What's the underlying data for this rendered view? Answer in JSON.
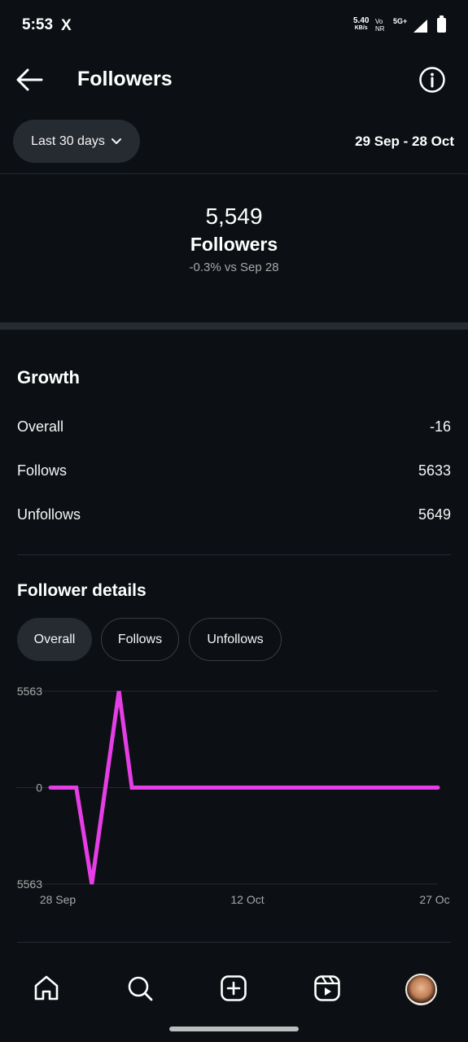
{
  "status_bar": {
    "time": "5:53",
    "x_icon": "X",
    "speed_value": "5.40",
    "speed_unit": "KB/s",
    "volte_top": "Vo",
    "volte_bottom": "NR",
    "network": "5G+"
  },
  "header": {
    "title": "Followers",
    "back_icon": "arrow-left-icon",
    "info_icon": "info-icon"
  },
  "filter": {
    "range_label": "Last 30 days",
    "date_range": "29 Sep - 28 Oct"
  },
  "summary": {
    "value": "5,549",
    "label": "Followers",
    "change": "-0.3% vs Sep 28"
  },
  "growth": {
    "title": "Growth",
    "rows": [
      {
        "label": "Overall",
        "value": "-16"
      },
      {
        "label": "Follows",
        "value": "5633"
      },
      {
        "label": "Unfollows",
        "value": "5649"
      }
    ]
  },
  "follower_details": {
    "title": "Follower details",
    "tabs": [
      {
        "label": "Overall",
        "active": true
      },
      {
        "label": "Follows",
        "active": false
      },
      {
        "label": "Unfollows",
        "active": false
      }
    ]
  },
  "chart_data": {
    "type": "line",
    "y_tick_labels": [
      "5563",
      "0",
      "5563"
    ],
    "x_tick_labels": [
      "28 Sep",
      "12 Oct",
      "27 Oc"
    ],
    "ylim": [
      -5563,
      5563
    ],
    "series_color": "#e63ee6",
    "points": [
      {
        "x": 0,
        "y": 0
      },
      {
        "x": 2,
        "y": 0
      },
      {
        "x": 3.2,
        "y": -5563
      },
      {
        "x": 5.3,
        "y": 5563
      },
      {
        "x": 6.3,
        "y": 0
      },
      {
        "x": 30,
        "y": 0
      }
    ],
    "grid": true
  },
  "bottom_nav": {
    "items": [
      "home-icon",
      "search-icon",
      "create-icon",
      "reels-icon",
      "profile-avatar"
    ]
  },
  "colors": {
    "background": "#0c1014",
    "surface": "#262a31",
    "text_primary": "#f5f5f5",
    "text_secondary": "#a8a8a8",
    "chart_line": "#e63ee6"
  }
}
